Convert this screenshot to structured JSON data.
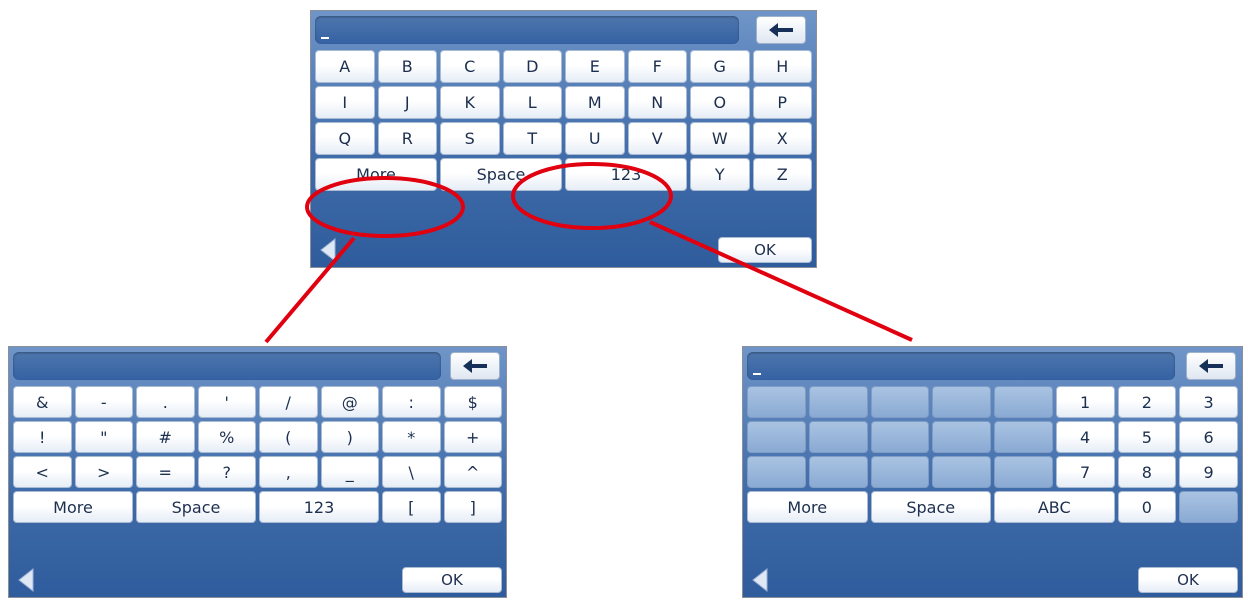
{
  "keyboards": {
    "alpha": {
      "input_value": "",
      "rows": [
        [
          "A",
          "B",
          "C",
          "D",
          "E",
          "F",
          "G",
          "H"
        ],
        [
          "I",
          "J",
          "K",
          "L",
          "M",
          "N",
          "O",
          "P"
        ],
        [
          "Q",
          "R",
          "S",
          "T",
          "U",
          "V",
          "W",
          "X"
        ]
      ],
      "last_row": {
        "more": "More",
        "space": "Space",
        "numbers": "123",
        "y": "Y",
        "z": "Z"
      },
      "ok_label": "OK"
    },
    "symbols": {
      "rows": [
        [
          "&",
          "-",
          ".",
          "'",
          "/",
          "@",
          ":",
          "$"
        ],
        [
          "!",
          "\"",
          "#",
          "%",
          "(",
          ")",
          "*",
          "+"
        ],
        [
          "<",
          ">",
          "=",
          "?",
          ",",
          "_",
          "\\",
          "^"
        ]
      ],
      "last_row": {
        "more": "More",
        "space": "Space",
        "numbers": "123",
        "lbracket": "[",
        "rbracket": "]"
      },
      "ok_label": "OK"
    },
    "numeric": {
      "rows": [
        [
          "1",
          "2",
          "3"
        ],
        [
          "4",
          "5",
          "6"
        ],
        [
          "7",
          "8",
          "9"
        ]
      ],
      "last_row": {
        "more": "More",
        "space": "Space",
        "abc": "ABC",
        "zero": "0"
      },
      "ok_label": "OK"
    }
  },
  "colors": {
    "accent": "#e0000f",
    "panel": "#3e6aa8"
  },
  "icons": {
    "backspace": "left-arrow-icon",
    "back": "back-triangle-icon"
  }
}
